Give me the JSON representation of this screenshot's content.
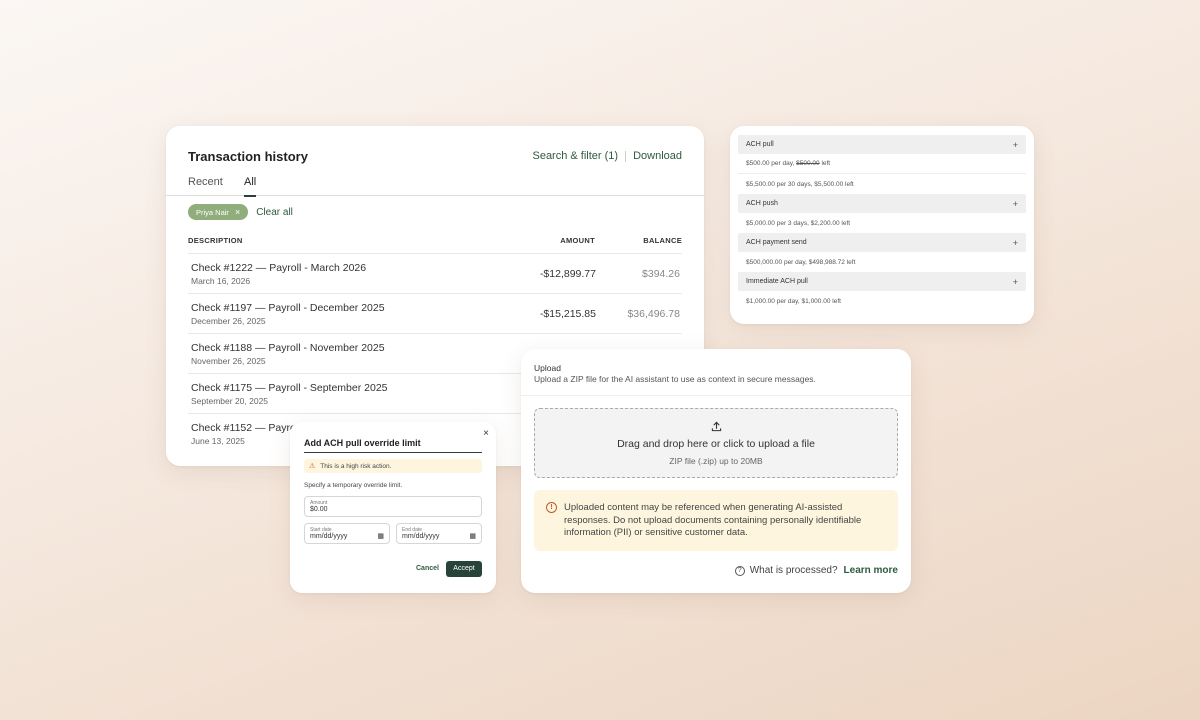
{
  "transactions": {
    "title": "Transaction history",
    "search_filter_label": "Search & filter (1)",
    "download_label": "Download",
    "tabs": [
      "Recent",
      "All"
    ],
    "active_tab": "All",
    "filter_chip": "Priya Nair",
    "clear_all_label": "Clear all",
    "columns": {
      "description": "DESCRIPTION",
      "amount": "AMOUNT",
      "balance": "BALANCE"
    },
    "rows": [
      {
        "description": "Check #1222 — Payroll - March 2026",
        "date": "March 16, 2026",
        "amount": "-$12,899.77",
        "balance": "$394.26"
      },
      {
        "description": "Check #1197 — Payroll - December 2025",
        "date": "December 26, 2025",
        "amount": "-$15,215.85",
        "balance": "$36,496.78"
      },
      {
        "description": "Check #1188 — Payroll - November 2025",
        "date": "November 26, 2025",
        "amount": "",
        "balance": ""
      },
      {
        "description": "Check #1175 — Payroll - September 2025",
        "date": "September 20, 2025",
        "amount": "",
        "balance": ""
      },
      {
        "description": "Check #1152 — Payroll",
        "date": "June 13, 2025",
        "amount": "",
        "balance": ""
      }
    ]
  },
  "limits": {
    "ach_pull": {
      "title": "ACH pull",
      "line1_prefix": "$500.00 per day, ",
      "line1_struck": "$500.00",
      "line1_suffix": " left",
      "line2": "$5,500.00 per 30 days, $5,500.00 left"
    },
    "ach_push": {
      "title": "ACH push",
      "line1": "$5,000.00 per 3 days, $2,200.00 left"
    },
    "ach_payment_send": {
      "title": "ACH payment send",
      "line1": "$500,000.00 per day, $498,988.72 left"
    },
    "immediate_ach_pull": {
      "title": "Immediate ACH pull",
      "line1": "$1,000.00 per day, $1,000.00 left"
    }
  },
  "upload": {
    "title": "Upload",
    "subtitle": "Upload a ZIP file for the AI assistant to use as context in secure messages.",
    "drop_label": "Drag and drop here or click to upload a file",
    "drop_hint": "ZIP file (.zip) up to 20MB",
    "warning": "Uploaded content may be referenced when generating AI-assisted responses. Do not upload documents containing personally identifiable information (PII) or sensitive customer data.",
    "footer_question": "What is processed?",
    "learn_more": "Learn more"
  },
  "modal": {
    "title": "Add ACH pull override limit",
    "alert": "This is a high risk action.",
    "instruction": "Specify a temporary override limit.",
    "amount_label": "Amount",
    "amount_value": "$0.00",
    "start_label": "Start date",
    "start_placeholder": "mm/dd/yyyy",
    "end_label": "End date",
    "end_placeholder": "mm/dd/yyyy",
    "cancel_label": "Cancel",
    "accept_label": "Accept"
  },
  "colors": {
    "accent_green": "#2f5a3f",
    "chip_green": "#8fae7b",
    "warning_bg": "#fdf5de",
    "warning_icon": "#c0582a",
    "primary_button": "#27433a"
  }
}
